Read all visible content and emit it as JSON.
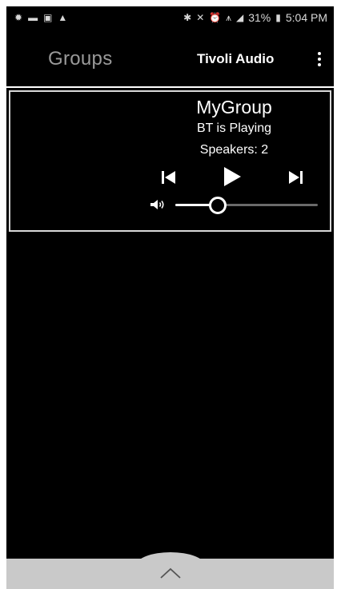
{
  "status_bar": {
    "battery": "31%",
    "time": "5:04 PM",
    "icons_left": [
      "settings-icon",
      "notification-icon",
      "image-icon",
      "warning-icon"
    ],
    "icons_right": [
      "bluetooth-icon",
      "mute-icon",
      "alarm-icon",
      "wifi-icon",
      "signal-icon",
      "battery-icon"
    ]
  },
  "app_bar": {
    "title": "Groups",
    "brand": "Tivoli Audio",
    "menu_icon": "more-vert-icon"
  },
  "group": {
    "name": "MyGroup",
    "status": "BT is Playing",
    "speakers": "Speakers:  2",
    "volume": 0.3
  },
  "colors": {
    "background": "#000000",
    "text": "#ffffff",
    "title_gray": "#9a9a9a",
    "bottom_bar": "#c9c9c9"
  }
}
